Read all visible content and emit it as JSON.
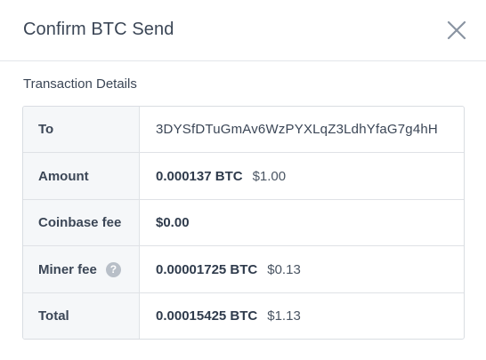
{
  "modal": {
    "title": "Confirm BTC Send",
    "close_icon": "close-icon"
  },
  "section": {
    "label": "Transaction Details"
  },
  "rows": [
    {
      "label": "To",
      "value": "3DYSfDTuGmAv6WzPYXLqZ3LdhYfaG7g4hH"
    },
    {
      "label": "Amount",
      "btc": "0.000137 BTC",
      "usd": "$1.00"
    },
    {
      "label": "Coinbase fee",
      "btc": "$0.00"
    },
    {
      "label": "Miner fee",
      "btc": "0.00001725 BTC",
      "usd": "$0.13",
      "help_icon": "help-icon",
      "help_glyph": "?"
    },
    {
      "label": "Total",
      "btc": "0.00015425 BTC",
      "usd": "$1.13"
    }
  ],
  "colors": {
    "text": "#3b4656",
    "label_bg": "#f5f7f9",
    "border": "#dfe2e6",
    "help_icon_bg": "#b8bfc8"
  }
}
